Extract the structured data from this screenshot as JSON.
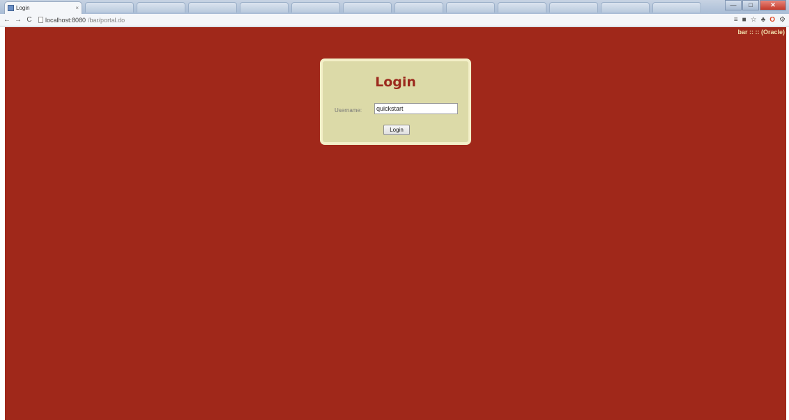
{
  "browser": {
    "tab_title": "Login",
    "tab_close": "×",
    "url_host": "localhost:8080",
    "url_path": "/bar/portal.do",
    "minimize": "—",
    "maximize": "□",
    "close": "✕"
  },
  "page": {
    "top_right_info": "bar :: :: (Oracle)",
    "login": {
      "title": "Login",
      "username_label": "Username:",
      "username_value": "quickstart",
      "button_label": "Login"
    },
    "background_color": "#a0281a",
    "box_color": "#dcdaa8",
    "title_color": "#9c2a1e"
  }
}
